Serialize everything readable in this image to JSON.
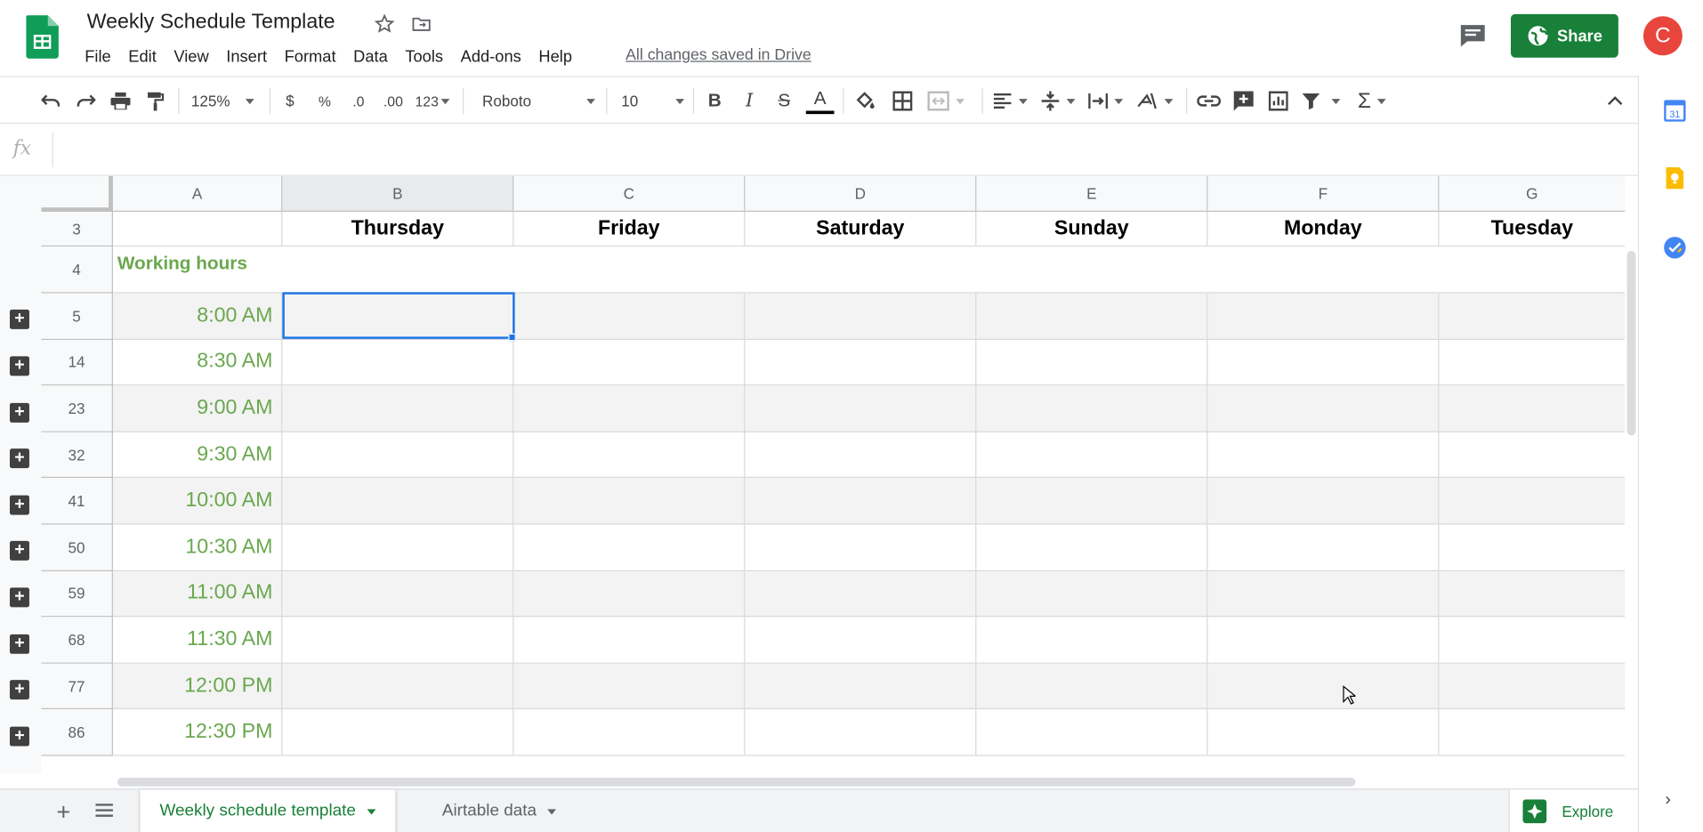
{
  "document": {
    "title": "Weekly Schedule Template",
    "save_status": "All changes saved in Drive"
  },
  "menu": [
    "File",
    "Edit",
    "View",
    "Insert",
    "Format",
    "Data",
    "Tools",
    "Add-ons",
    "Help"
  ],
  "header": {
    "share_label": "Share",
    "avatar_initial": "C"
  },
  "toolbar": {
    "zoom": "125%",
    "currency": "$",
    "percent": "%",
    "decimal_decrease": ".0",
    "decimal_increase": ".00",
    "more_formats": "123",
    "font": "Roboto",
    "font_size": "10",
    "bold": "B",
    "italic": "I",
    "strike": "S",
    "text_color": "A"
  },
  "formula_bar": {
    "fx_label": "fx",
    "value": ""
  },
  "columns": [
    "A",
    "B",
    "C",
    "D",
    "E",
    "F",
    "G"
  ],
  "selected_column": "B",
  "day_row": {
    "row_number": "3",
    "days": [
      "Thursday",
      "Friday",
      "Saturday",
      "Sunday",
      "Monday",
      "Tuesday"
    ]
  },
  "label_row": {
    "row_number": "4",
    "label": "Working hours"
  },
  "time_rows": [
    {
      "row": "5",
      "time": "8:00 AM"
    },
    {
      "row": "14",
      "time": "8:30 AM"
    },
    {
      "row": "23",
      "time": "9:00 AM"
    },
    {
      "row": "32",
      "time": "9:30 AM"
    },
    {
      "row": "41",
      "time": "10:00 AM"
    },
    {
      "row": "50",
      "time": "10:30 AM"
    },
    {
      "row": "59",
      "time": "11:00 AM"
    },
    {
      "row": "68",
      "time": "11:30 AM"
    },
    {
      "row": "77",
      "time": "12:00 PM"
    },
    {
      "row": "86",
      "time": "12:30 PM"
    }
  ],
  "sheets": {
    "active": "Weekly schedule template",
    "other": "Airtable data",
    "explore_label": "Explore"
  },
  "colors": {
    "brand_green": "#188038",
    "time_green": "#6aa84f",
    "selection_blue": "#1a73e8",
    "avatar_red": "#e8453c"
  }
}
